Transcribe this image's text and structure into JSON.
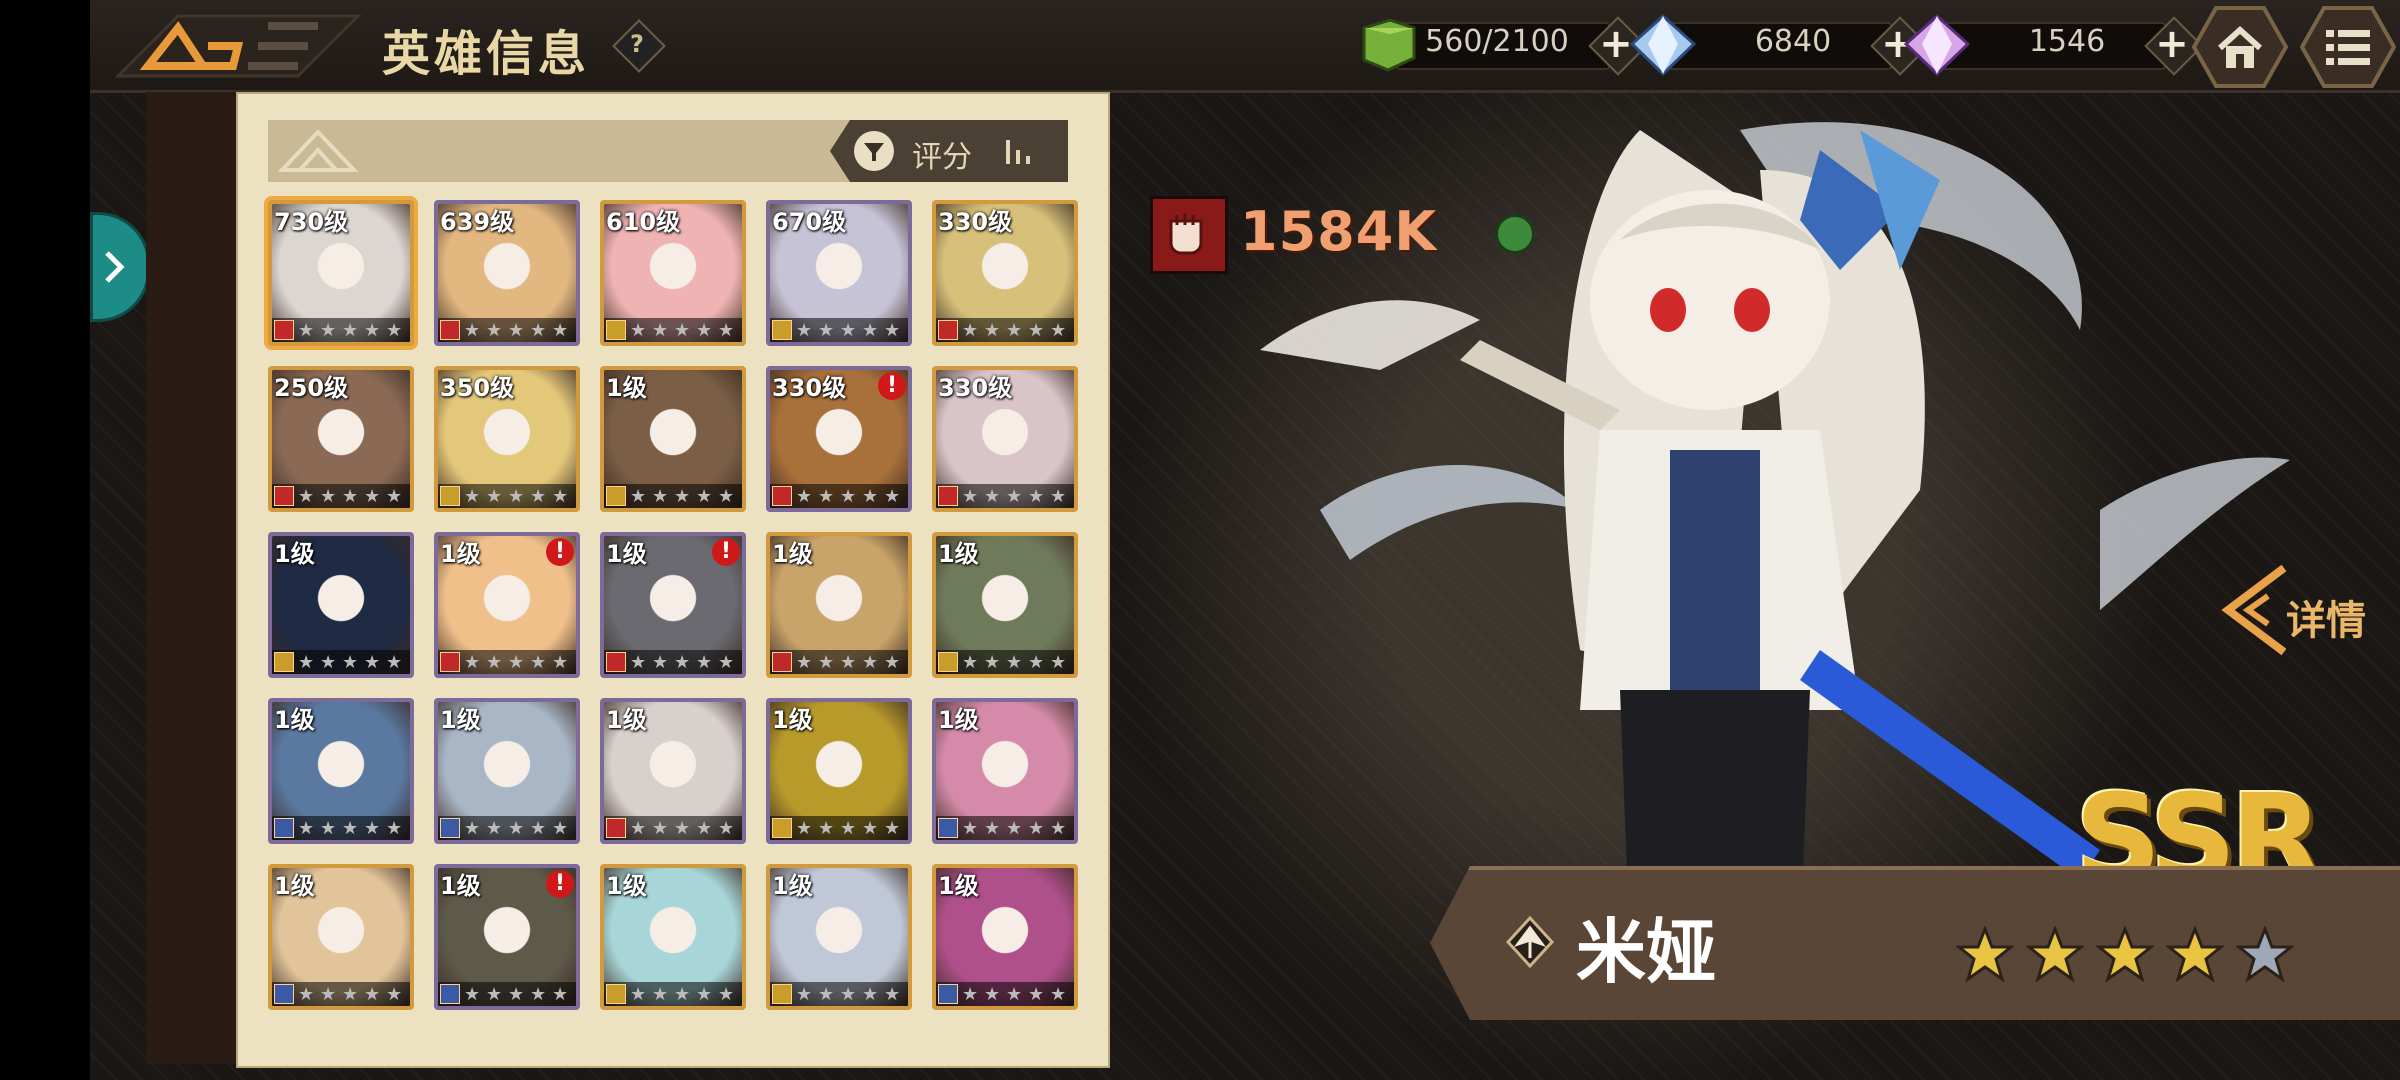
{
  "header": {
    "title": "英雄信息",
    "help": "?",
    "resources": [
      {
        "name": "stamina",
        "icon": "green-cube-icon",
        "value": "560/2100"
      },
      {
        "name": "diamond",
        "icon": "blue-crystal-icon",
        "value": "6840"
      },
      {
        "name": "crystal",
        "icon": "purple-crystal-icon",
        "value": "1546"
      }
    ],
    "plus": "+"
  },
  "roster": {
    "sort_label": "评分",
    "heroes": [
      {
        "level": "730级",
        "color": "#dcd6d0",
        "frame": "#d19a3c",
        "class_color": "#c0282a",
        "stars": 5,
        "alert": false,
        "selected": true
      },
      {
        "level": "639级",
        "color": "#e2b780",
        "frame": "#7b6a9a",
        "class_color": "#c0282a",
        "stars": 5,
        "alert": false
      },
      {
        "level": "610级",
        "color": "#efb3b3",
        "frame": "#d19a3c",
        "class_color": "#c99d2a",
        "stars": 5,
        "alert": false
      },
      {
        "level": "670级",
        "color": "#c7c3d6",
        "frame": "#7b6a9a",
        "class_color": "#c99d2a",
        "stars": 5,
        "alert": false
      },
      {
        "level": "330级",
        "color": "#d7c07a",
        "frame": "#d19a3c",
        "class_color": "#c0282a",
        "stars": 5,
        "alert": false
      },
      {
        "level": "250级",
        "color": "#8a6a55",
        "frame": "#d19a3c",
        "class_color": "#c0282a",
        "stars": 5,
        "alert": false
      },
      {
        "level": "350级",
        "color": "#e4c87a",
        "frame": "#d19a3c",
        "class_color": "#c99d2a",
        "stars": 5,
        "alert": false
      },
      {
        "level": "1级",
        "color": "#7b5e46",
        "frame": "#d19a3c",
        "class_color": "#c99d2a",
        "stars": 5,
        "alert": false
      },
      {
        "level": "330级",
        "color": "#a8703a",
        "frame": "#7b6a9a",
        "class_color": "#c0282a",
        "stars": 5,
        "alert": true
      },
      {
        "level": "330级",
        "color": "#d9c4c8",
        "frame": "#d19a3c",
        "class_color": "#c0282a",
        "stars": 5,
        "alert": false
      },
      {
        "level": "1级",
        "color": "#1f2a44",
        "frame": "#7b6a9a",
        "class_color": "#c99d2a",
        "stars": 5,
        "alert": false
      },
      {
        "level": "1级",
        "color": "#f0c08a",
        "frame": "#7b6a9a",
        "class_color": "#c0282a",
        "stars": 5,
        "alert": true
      },
      {
        "level": "1级",
        "color": "#6a6a70",
        "frame": "#7b6a9a",
        "class_color": "#c0282a",
        "stars": 5,
        "alert": true
      },
      {
        "level": "1级",
        "color": "#c9a46a",
        "frame": "#d19a3c",
        "class_color": "#c0282a",
        "stars": 5,
        "alert": false
      },
      {
        "level": "1级",
        "color": "#6f7a5a",
        "frame": "#d19a3c",
        "class_color": "#c99d2a",
        "stars": 5,
        "alert": false
      },
      {
        "level": "1级",
        "color": "#5a78a0",
        "frame": "#7b6a9a",
        "class_color": "#3a5aa8",
        "stars": 5,
        "alert": false
      },
      {
        "level": "1级",
        "color": "#a9b6c6",
        "frame": "#7b6a9a",
        "class_color": "#3a5aa8",
        "stars": 5,
        "alert": false
      },
      {
        "level": "1级",
        "color": "#d8d0cc",
        "frame": "#7b6a9a",
        "class_color": "#c0282a",
        "stars": 5,
        "alert": false
      },
      {
        "level": "1级",
        "color": "#b89a2a",
        "frame": "#7b6a9a",
        "class_color": "#c99d2a",
        "stars": 5,
        "alert": false
      },
      {
        "level": "1级",
        "color": "#d48aa8",
        "frame": "#7b6a9a",
        "class_color": "#3a5aa8",
        "stars": 5,
        "alert": false
      },
      {
        "level": "1级",
        "color": "#e2c49a",
        "frame": "#d19a3c",
        "class_color": "#3a5aa8",
        "stars": 5,
        "alert": false
      },
      {
        "level": "1级",
        "color": "#5e5a4a",
        "frame": "#7b6a9a",
        "class_color": "#3a5aa8",
        "stars": 5,
        "alert": true
      },
      {
        "level": "1级",
        "color": "#a8d6d8",
        "frame": "#d19a3c",
        "class_color": "#c99d2a",
        "stars": 5,
        "alert": false
      },
      {
        "level": "1级",
        "color": "#c0c8d8",
        "frame": "#d19a3c",
        "class_color": "#c99d2a",
        "stars": 5,
        "alert": false
      },
      {
        "level": "1级",
        "color": "#b0508a",
        "frame": "#d19a3c",
        "class_color": "#3a5aa8",
        "stars": 5,
        "alert": false
      }
    ]
  },
  "hero": {
    "power": "1584K",
    "name": "米娅",
    "rarity": "SSR",
    "details_label": "详情",
    "stars_total": 5,
    "stars_gold": 4
  }
}
